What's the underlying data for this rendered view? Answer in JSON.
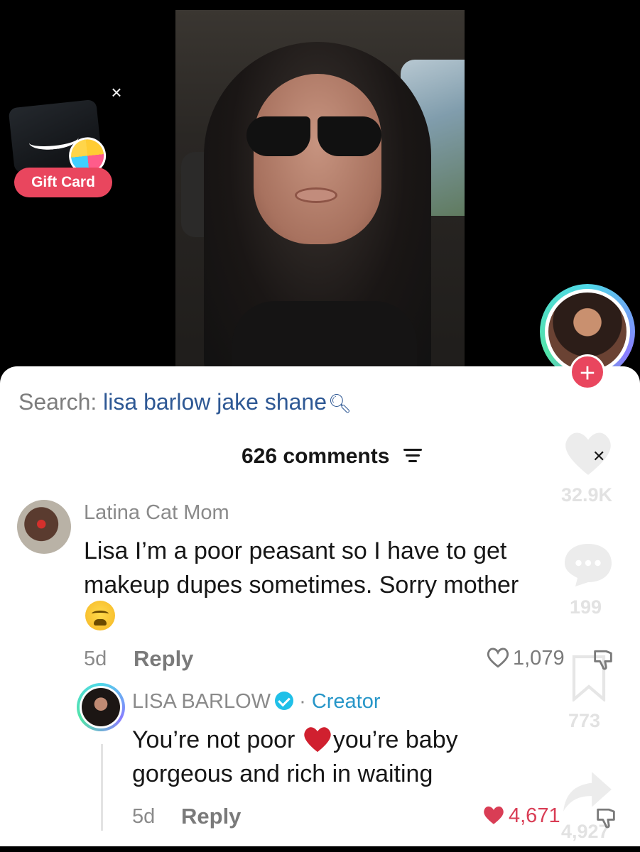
{
  "gift_card": {
    "label": "Gift Card",
    "close_glyph": "×"
  },
  "search": {
    "prefix": "Search: ",
    "query": "lisa barlow jake shane"
  },
  "comments": {
    "count_label": "626 comments"
  },
  "side_actions": {
    "likes": "32.9K",
    "comments": "199",
    "saves": "773",
    "shares": "4,927"
  },
  "comment": {
    "author": "Latina Cat Mom",
    "text": "Lisa I’m a poor peasant so I have to get makeup dupes sometimes. Sorry mother",
    "age": "5d",
    "reply_label": "Reply",
    "likes": "1,079"
  },
  "reply": {
    "author": "LISA BARLOW",
    "separator": "·",
    "creator_badge": "Creator",
    "text_before": "You’re not poor ",
    "text_after": "you’re baby gorgeous and rich in waiting",
    "age": "5d",
    "reply_label": "Reply",
    "likes": "4,671"
  },
  "colors": {
    "accent": "#e9465e",
    "link": "#2e5894",
    "liked": "#d93d55",
    "creator": "#2796c8"
  }
}
